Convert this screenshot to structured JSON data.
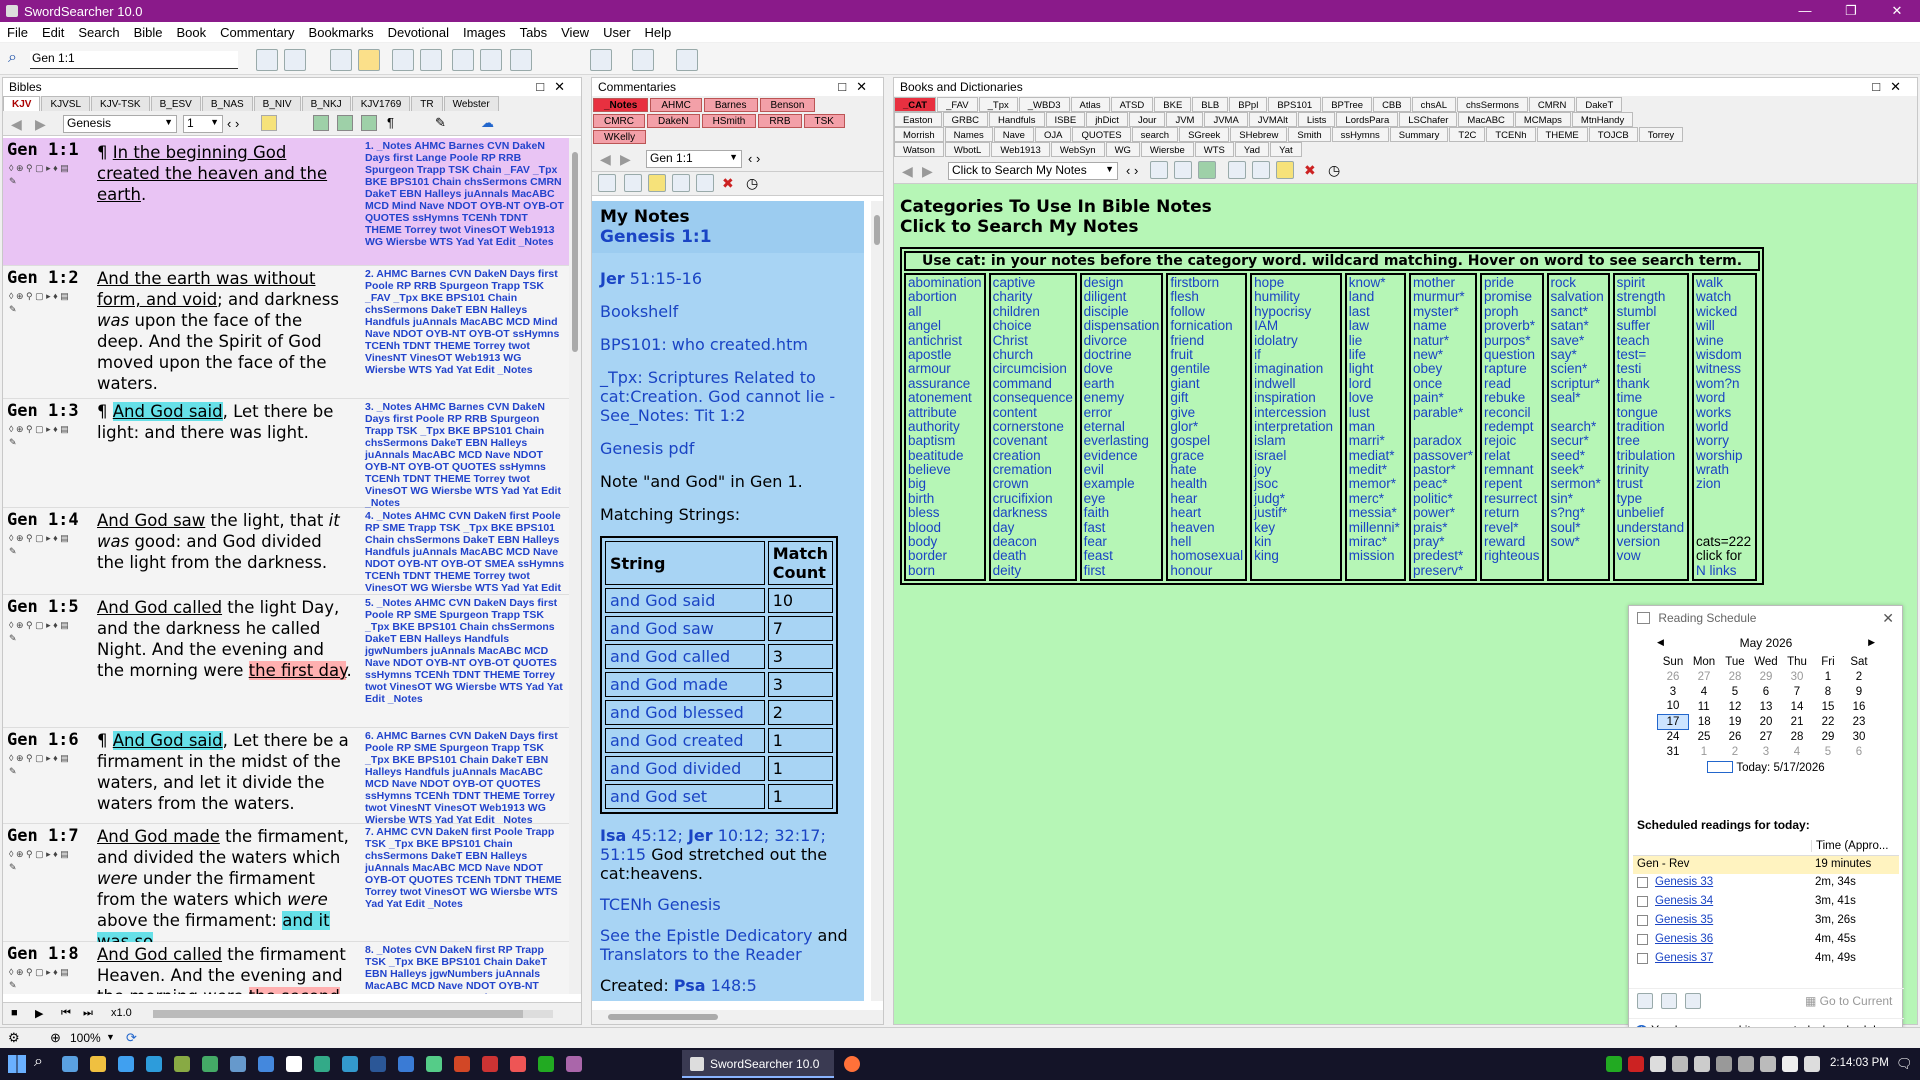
{
  "app": {
    "title": "SwordSearcher 10.0"
  },
  "menu": [
    "File",
    "Edit",
    "Search",
    "Bible",
    "Book",
    "Commentary",
    "Bookmarks",
    "Devotional",
    "Images",
    "Tabs",
    "View",
    "User",
    "Help"
  ],
  "search": {
    "value": "Gen 1:1"
  },
  "bibles": {
    "title": "Bibles",
    "tabs": [
      "KJV",
      "KJVSL",
      "KJV-TSK",
      "B_ESV",
      "B_NAS",
      "B_NIV",
      "B_NKJ",
      "KJV1769",
      "TR",
      "Webster"
    ],
    "book": "Genesis",
    "chapter": "1",
    "speed": "x1.0",
    "verses": [
      {
        "ref": "Gen 1:1",
        "segments": [
          {
            "t": "¶ ",
            "c": ""
          },
          {
            "t": "In the beginning God created the heaven and the earth",
            "c": "u"
          },
          {
            "t": ".",
            "c": ""
          }
        ],
        "refs": "1. _Notes AHMC Barnes CVN DakeN Days first Lange Poole RP RRB Spurgeon Trapp TSK Chain _FAV _Tpx BKE BPS101 Chain chsSermons CMRN DakeT EBN Halleys juAnnals MacABC MCD Mind Nave NDOT OYB-NT OYB-OT QUOTES ssHymns TCENh TDNT THEME Torrey twot VinesOT Web1913 WG Wiersbe WTS Yad Yat Edit _Notes",
        "bg": "#e9c4f4"
      },
      {
        "ref": "Gen 1:2",
        "segments": [
          {
            "t": "And the earth was without form, and void",
            "c": "u"
          },
          {
            "t": "; and darkness ",
            "c": ""
          },
          {
            "t": "was",
            "c": "i"
          },
          {
            "t": " upon the face of the deep. And the Spirit of God moved upon the face of the waters.",
            "c": ""
          }
        ],
        "refs": "2. AHMC Barnes CVN DakeN Days first Poole RP RRB Spurgeon Trapp TSK _FAV _Tpx BKE BPS101 Chain chsSermons DakeT EBN Halleys Handfuls juAnnals MacABC MCD Mind Nave NDOT OYB-NT OYB-OT ssHymns TCENh TDNT THEME Torrey twot VinesNT VinesOT Web1913 WG Wiersbe WTS Yad Yat Edit _Notes",
        "bg": "#f4f4f4"
      },
      {
        "ref": "Gen 1:3",
        "segments": [
          {
            "t": "¶ ",
            "c": ""
          },
          {
            "t": "And God said",
            "c": "hc u"
          },
          {
            "t": ", Let there be light: and there was light.",
            "c": ""
          }
        ],
        "refs": "3. _Notes AHMC Barnes CVN DakeN Days first Poole RP RRB Spurgeon Trapp TSK _Tpx BKE BPS101 Chain chsSermons DakeT EBN Halleys juAnnals MacABC MCD Nave NDOT OYB-NT OYB-OT QUOTES ssHymns TCENh TDNT THEME Torrey twot VinesOT WG Wiersbe WTS Yad Yat Edit _Notes",
        "bg": "#f4f4f4"
      },
      {
        "ref": "Gen 1:4",
        "segments": [
          {
            "t": "And God saw",
            "c": "u"
          },
          {
            "t": " the light, that ",
            "c": ""
          },
          {
            "t": "it was",
            "c": "i"
          },
          {
            "t": " good: and God divided the light from the darkness.",
            "c": ""
          }
        ],
        "refs": "4. _Notes AHMC CVN DakeN first Poole RP SME Trapp TSK _Tpx BKE BPS101 Chain chsSermons DakeT EBN Halleys Handfuls juAnnals MacABC MCD Nave NDOT OYB-NT OYB-OT SMEA ssHymns TCENh TDNT THEME Torrey twot VinesOT WG Wiersbe WTS Yad Yat Edit _Notes",
        "bg": "#f4f4f4"
      },
      {
        "ref": "Gen 1:5",
        "segments": [
          {
            "t": "And God called",
            "c": "u"
          },
          {
            "t": " the light Day, and the darkness he called Night. And the evening and the morning were ",
            "c": ""
          },
          {
            "t": "the first day",
            "c": "hr u"
          },
          {
            "t": ".",
            "c": ""
          }
        ],
        "refs": "5. _Notes AHMC CVN DakeN Days first Poole RP SME Spurgeon Trapp TSK _Tpx BKE BPS101 Chain chsSermons DakeT EBN Halleys Handfuls jgwNumbers juAnnals MacABC MCD Nave NDOT OYB-NT OYB-OT QUOTES ssHymns TCENh TDNT THEME Torrey twot VinesOT WG Wiersbe WTS Yad Yat Edit _Notes",
        "bg": "#f4f4f4"
      },
      {
        "ref": "Gen 1:6",
        "segments": [
          {
            "t": "¶ ",
            "c": ""
          },
          {
            "t": "And God said",
            "c": "hc u"
          },
          {
            "t": ", Let there be a firmament in the midst of the waters, and let it divide the waters from the waters.",
            "c": ""
          }
        ],
        "refs": "6. AHMC Barnes CVN DakeN Days first Poole RP SME Spurgeon Trapp TSK _Tpx BKE BPS101 Chain DakeT EBN Halleys Handfuls juAnnals MacABC MCD Nave NDOT OYB-OT QUOTES ssHymns TCENh TDNT THEME Torrey twot VinesNT VinesOT Web1913 WG Wiersbe WTS Yad Yat Edit _Notes",
        "bg": "#f4f4f4"
      },
      {
        "ref": "Gen 1:7",
        "segments": [
          {
            "t": "And God made",
            "c": "u"
          },
          {
            "t": " the firmament, and divided the waters which ",
            "c": ""
          },
          {
            "t": "were",
            "c": "i"
          },
          {
            "t": " under the firmament from the waters which ",
            "c": ""
          },
          {
            "t": "were",
            "c": "i"
          },
          {
            "t": " above the firmament: ",
            "c": ""
          },
          {
            "t": "and it was so",
            "c": "hc"
          },
          {
            "t": ".",
            "c": ""
          }
        ],
        "refs": "7. AHMC CVN DakeN first Poole Trapp TSK _Tpx BKE BPS101 Chain chsSermons DakeT EBN Halleys juAnnals MacABC MCD Nave NDOT OYB-OT QUOTES TCENh TDNT THEME Torrey twot VinesOT WG Wiersbe WTS Yad Yat Edit _Notes",
        "bg": "#f4f4f4"
      },
      {
        "ref": "Gen 1:8",
        "segments": [
          {
            "t": "And God called",
            "c": "u"
          },
          {
            "t": " the firmament Heaven. And the evening and the morning were ",
            "c": ""
          },
          {
            "t": "the second",
            "c": "hr"
          }
        ],
        "refs": "8. _Notes CVN DakeN first RP Trapp TSK _Tpx BKE BPS101 Chain DakeT EBN Halleys jgwNumbers juAnnals MacABC MCD Nave NDOT OYB-NT OYB-OT QUOTES TCENh TDNT",
        "bg": "#f4f4f4"
      }
    ]
  },
  "commentaries": {
    "title": "Commentaries",
    "tabs_row1": [
      "_Notes",
      "AHMC",
      "Barnes",
      "Benson"
    ],
    "tabs_row2": [
      "CMRC",
      "DakeN",
      "HSmith",
      "RRB",
      "TSK"
    ],
    "tabs_row3": [
      "WKelly"
    ],
    "ref_select": "Gen 1:1",
    "heading": "My Notes",
    "subheading": "Genesis 1:1",
    "jer": "Jer",
    "jer_ref": " 51:15-16",
    "bookshelf": "Bookshelf",
    "bps": "BPS101: who created.htm",
    "tpx": "_Tpx: Scriptures Related to cat:Creation.  God cannot lie - See_Notes: Tit 1:2",
    "pdf": "Genesis pdf",
    "note_text": "Note \"and God\" in Gen 1.",
    "matching": "Matching Strings:",
    "table_headers": [
      "String",
      "Match Count"
    ],
    "table_rows": [
      [
        "and God said",
        "10"
      ],
      [
        "and God saw",
        "7"
      ],
      [
        "and God called",
        "3"
      ],
      [
        "and God made",
        "3"
      ],
      [
        "and God blessed",
        "2"
      ],
      [
        "and God created",
        "1"
      ],
      [
        "and God divided",
        "1"
      ],
      [
        "and God set",
        "1"
      ]
    ],
    "isa": "Isa",
    "isa_ref": " 45:12; ",
    "jer2": "Jer",
    "jer2_ref": " 10:12; 32:17; 51:15",
    "isa_text": " God stretched out the cat:heavens.",
    "tcenh": "TCENh Genesis",
    "epistle": "See the Epistle Dedicatory",
    "epistle_and": " and",
    "translators": "Translators to the Reader",
    "created": "Created: ",
    "psa": "Psa",
    "psa_ref": " 148:5"
  },
  "books": {
    "title": "Books and Dictionaries",
    "row1": [
      "_CAT",
      "_FAV",
      "_Tpx",
      "_WBD3",
      "Atlas",
      "ATSD",
      "BKE",
      "BLB",
      "BPpl",
      "BPS101",
      "BPTree",
      "CBB",
      "chsAL",
      "chsSermons",
      "CMRN",
      "DakeT"
    ],
    "row2": [
      "Easton",
      "GRBC",
      "Handfuls",
      "ISBE",
      "jhDict",
      "Jour",
      "JVM",
      "JVMA",
      "JVMAlt",
      "Lists",
      "LordsPara",
      "LSChafer",
      "MacABC",
      "MCMaps",
      "MtnHandy"
    ],
    "row3": [
      "Morrish",
      "Names",
      "Nave",
      "OJA",
      "QUOTES",
      "search",
      "SGreek",
      "SHebrew",
      "Smith",
      "ssHymns",
      "Summary",
      "T2C",
      "TCENh",
      "THEME",
      "TOJCB",
      "Torrey"
    ],
    "row4": [
      "Watson",
      "WbotL",
      "Web1913",
      "WebSyn",
      "WG",
      "Wiersbe",
      "WTS",
      "Yad",
      "Yat"
    ],
    "search_select": "Click to Search My Notes",
    "heading1": "Categories To Use In Bible Notes",
    "heading2": "Click to Search My Notes",
    "cat_header": "Use cat: in your notes before the category word.  wildcard matching.  Hover on word to see search term.",
    "columns": [
      [
        "abomination",
        "abortion",
        "all",
        "angel",
        "antichrist",
        "apostle",
        "armour",
        "assurance",
        "atonement",
        "attribute",
        "authority",
        "baptism",
        "beatitude",
        "believe",
        "big",
        "birth",
        "bless",
        "blood",
        "body",
        "border",
        "born"
      ],
      [
        "captive",
        "charity",
        "children",
        "choice",
        "Christ",
        "church",
        "circumcision",
        "command",
        "consequence",
        "content",
        "cornerstone",
        "covenant",
        "creation",
        "cremation",
        "crown",
        "crucifixion",
        "darkness",
        "day",
        "deacon",
        "death",
        "deity"
      ],
      [
        "design",
        "diligent",
        "disciple",
        "dispensation",
        "divorce",
        "doctrine",
        "dove",
        "earth",
        "enemy",
        "error",
        "eternal",
        "everlasting",
        "evidence",
        "evil",
        "example",
        "eye",
        "faith",
        "fast",
        "fear",
        "feast",
        "first"
      ],
      [
        "firstborn",
        "flesh",
        "follow",
        "fornication",
        "friend",
        "fruit",
        "gentile",
        "giant",
        "gift",
        "give",
        "glor*",
        "gospel",
        "grace",
        "hate",
        "health",
        "hear",
        "heart",
        "heaven",
        "hell",
        "homosexual",
        "honour"
      ],
      [
        "hope",
        "humility",
        "hypocrisy",
        "IAM",
        "idolatry",
        "if",
        "imagination",
        "indwell",
        "inspiration",
        "intercession",
        "interpretation",
        "islam",
        "israel",
        "joy",
        "jsoc",
        "judg*",
        "justif*",
        "key",
        "kin",
        "king"
      ],
      [
        "know*",
        "land",
        "last",
        "law",
        "lie",
        "life",
        "light",
        "lord",
        "love",
        "lust",
        "man",
        "marri*",
        "mediat*",
        "medit*",
        "memor*",
        "merc*",
        "messia*",
        "millenni*",
        "mirac*",
        "mission"
      ],
      [
        "mother",
        "murmur*",
        "myster*",
        "name",
        "natur*",
        "new*",
        "obey",
        "once",
        "pain*",
        "parable*",
        "",
        "paradox",
        "passover*",
        "pastor*",
        "peac*",
        "politic*",
        "power*",
        "prais*",
        "pray*",
        "predest*",
        "preserv*"
      ],
      [
        "pride",
        "promise",
        "proph",
        "proverb*",
        "purpos*",
        "question",
        "rapture",
        "read",
        "rebuke",
        "reconcil",
        "redempt",
        "rejoic",
        "relat",
        "remnant",
        "repent",
        "resurrect",
        "return",
        "revel*",
        "reward",
        "righteous"
      ],
      [
        "rock",
        "salvation",
        "sanct*",
        "satan*",
        "save*",
        "say*",
        "scien*",
        "scriptur*",
        "seal*",
        "",
        "search*",
        "secur*",
        "seed*",
        "seek*",
        "sermon*",
        "sin*",
        "s?ng*",
        "soul*",
        "sow*"
      ],
      [
        "spirit",
        "strength",
        "stumbl",
        "suffer",
        "teach",
        "test=",
        "testi",
        "thank",
        "time",
        "tongue",
        "tradition",
        "tree",
        "tribulation",
        "trinity",
        "trust",
        "type",
        "unbelief",
        "understand",
        "version",
        "vow"
      ],
      [
        "walk",
        "watch",
        "wicked",
        "will",
        "wine",
        "wisdom",
        "witness",
        "wom?n",
        "word",
        "works",
        "world",
        "worry",
        "worship",
        "wrath",
        "zion",
        "",
        "",
        "",
        "cats=222",
        "click for",
        "N links"
      ]
    ]
  },
  "schedule": {
    "title": "Reading Schedule",
    "month": "May 2026",
    "weekdays": [
      "Sun",
      "Mon",
      "Tue",
      "Wed",
      "Thu",
      "Fri",
      "Sat"
    ],
    "weeks": [
      [
        "26",
        "27",
        "28",
        "29",
        "30",
        "1",
        "2"
      ],
      [
        "3",
        "4",
        "5",
        "6",
        "7",
        "8",
        "9"
      ],
      [
        "10",
        "11",
        "12",
        "13",
        "14",
        "15",
        "16"
      ],
      [
        "17",
        "18",
        "19",
        "20",
        "21",
        "22",
        "23"
      ],
      [
        "24",
        "25",
        "26",
        "27",
        "28",
        "29",
        "30"
      ],
      [
        "31",
        "1",
        "2",
        "3",
        "4",
        "5",
        "6"
      ]
    ],
    "today": "Today: 5/17/2026",
    "scheduled_label": "Scheduled readings for today:",
    "col_time": "Time (Appro...",
    "plan": "Gen - Rev",
    "plan_time": "19 minutes",
    "readings": [
      [
        "Genesis 33",
        "2m, 34s"
      ],
      [
        "Genesis 34",
        "3m, 41s"
      ],
      [
        "Genesis 35",
        "3m, 26s"
      ],
      [
        "Genesis 36",
        "4m, 45s"
      ],
      [
        "Genesis 37",
        "4m, 49s"
      ]
    ],
    "goto": "Go to Current",
    "unread": "You have unread items on today's schedule."
  },
  "status": {
    "zoom": "100%"
  },
  "taskbar": {
    "app": "SwordSearcher 10.0",
    "time": "2:14:03 PM"
  },
  "colors": {
    "titlebar": "#8a1a8a",
    "notes_bg": "#a8d4f4",
    "books_bg": "#b6f6b6",
    "highlight_cyan": "#66e0e8",
    "highlight_red": "#ffb0b0"
  }
}
